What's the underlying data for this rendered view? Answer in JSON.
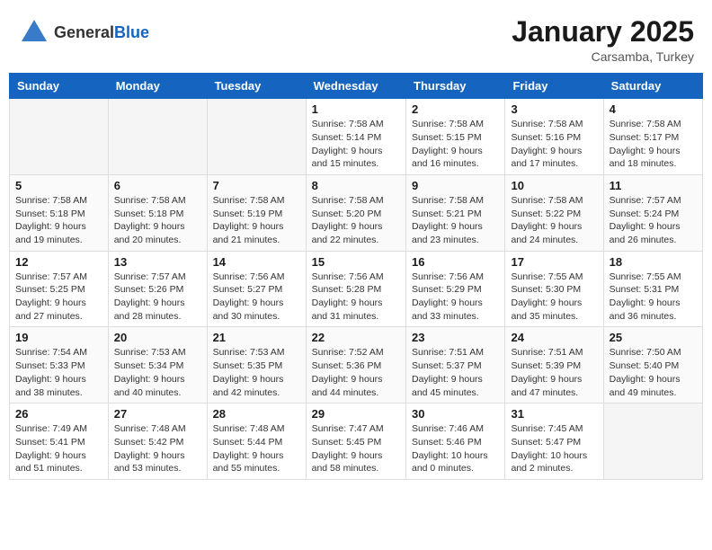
{
  "header": {
    "logo_general": "General",
    "logo_blue": "Blue",
    "month": "January 2025",
    "location": "Carsamba, Turkey"
  },
  "weekdays": [
    "Sunday",
    "Monday",
    "Tuesday",
    "Wednesday",
    "Thursday",
    "Friday",
    "Saturday"
  ],
  "weeks": [
    [
      {
        "day": "",
        "info": ""
      },
      {
        "day": "",
        "info": ""
      },
      {
        "day": "",
        "info": ""
      },
      {
        "day": "1",
        "info": "Sunrise: 7:58 AM\nSunset: 5:14 PM\nDaylight: 9 hours\nand 15 minutes."
      },
      {
        "day": "2",
        "info": "Sunrise: 7:58 AM\nSunset: 5:15 PM\nDaylight: 9 hours\nand 16 minutes."
      },
      {
        "day": "3",
        "info": "Sunrise: 7:58 AM\nSunset: 5:16 PM\nDaylight: 9 hours\nand 17 minutes."
      },
      {
        "day": "4",
        "info": "Sunrise: 7:58 AM\nSunset: 5:17 PM\nDaylight: 9 hours\nand 18 minutes."
      }
    ],
    [
      {
        "day": "5",
        "info": "Sunrise: 7:58 AM\nSunset: 5:18 PM\nDaylight: 9 hours\nand 19 minutes."
      },
      {
        "day": "6",
        "info": "Sunrise: 7:58 AM\nSunset: 5:18 PM\nDaylight: 9 hours\nand 20 minutes."
      },
      {
        "day": "7",
        "info": "Sunrise: 7:58 AM\nSunset: 5:19 PM\nDaylight: 9 hours\nand 21 minutes."
      },
      {
        "day": "8",
        "info": "Sunrise: 7:58 AM\nSunset: 5:20 PM\nDaylight: 9 hours\nand 22 minutes."
      },
      {
        "day": "9",
        "info": "Sunrise: 7:58 AM\nSunset: 5:21 PM\nDaylight: 9 hours\nand 23 minutes."
      },
      {
        "day": "10",
        "info": "Sunrise: 7:58 AM\nSunset: 5:22 PM\nDaylight: 9 hours\nand 24 minutes."
      },
      {
        "day": "11",
        "info": "Sunrise: 7:57 AM\nSunset: 5:24 PM\nDaylight: 9 hours\nand 26 minutes."
      }
    ],
    [
      {
        "day": "12",
        "info": "Sunrise: 7:57 AM\nSunset: 5:25 PM\nDaylight: 9 hours\nand 27 minutes."
      },
      {
        "day": "13",
        "info": "Sunrise: 7:57 AM\nSunset: 5:26 PM\nDaylight: 9 hours\nand 28 minutes."
      },
      {
        "day": "14",
        "info": "Sunrise: 7:56 AM\nSunset: 5:27 PM\nDaylight: 9 hours\nand 30 minutes."
      },
      {
        "day": "15",
        "info": "Sunrise: 7:56 AM\nSunset: 5:28 PM\nDaylight: 9 hours\nand 31 minutes."
      },
      {
        "day": "16",
        "info": "Sunrise: 7:56 AM\nSunset: 5:29 PM\nDaylight: 9 hours\nand 33 minutes."
      },
      {
        "day": "17",
        "info": "Sunrise: 7:55 AM\nSunset: 5:30 PM\nDaylight: 9 hours\nand 35 minutes."
      },
      {
        "day": "18",
        "info": "Sunrise: 7:55 AM\nSunset: 5:31 PM\nDaylight: 9 hours\nand 36 minutes."
      }
    ],
    [
      {
        "day": "19",
        "info": "Sunrise: 7:54 AM\nSunset: 5:33 PM\nDaylight: 9 hours\nand 38 minutes."
      },
      {
        "day": "20",
        "info": "Sunrise: 7:53 AM\nSunset: 5:34 PM\nDaylight: 9 hours\nand 40 minutes."
      },
      {
        "day": "21",
        "info": "Sunrise: 7:53 AM\nSunset: 5:35 PM\nDaylight: 9 hours\nand 42 minutes."
      },
      {
        "day": "22",
        "info": "Sunrise: 7:52 AM\nSunset: 5:36 PM\nDaylight: 9 hours\nand 44 minutes."
      },
      {
        "day": "23",
        "info": "Sunrise: 7:51 AM\nSunset: 5:37 PM\nDaylight: 9 hours\nand 45 minutes."
      },
      {
        "day": "24",
        "info": "Sunrise: 7:51 AM\nSunset: 5:39 PM\nDaylight: 9 hours\nand 47 minutes."
      },
      {
        "day": "25",
        "info": "Sunrise: 7:50 AM\nSunset: 5:40 PM\nDaylight: 9 hours\nand 49 minutes."
      }
    ],
    [
      {
        "day": "26",
        "info": "Sunrise: 7:49 AM\nSunset: 5:41 PM\nDaylight: 9 hours\nand 51 minutes."
      },
      {
        "day": "27",
        "info": "Sunrise: 7:48 AM\nSunset: 5:42 PM\nDaylight: 9 hours\nand 53 minutes."
      },
      {
        "day": "28",
        "info": "Sunrise: 7:48 AM\nSunset: 5:44 PM\nDaylight: 9 hours\nand 55 minutes."
      },
      {
        "day": "29",
        "info": "Sunrise: 7:47 AM\nSunset: 5:45 PM\nDaylight: 9 hours\nand 58 minutes."
      },
      {
        "day": "30",
        "info": "Sunrise: 7:46 AM\nSunset: 5:46 PM\nDaylight: 10 hours\nand 0 minutes."
      },
      {
        "day": "31",
        "info": "Sunrise: 7:45 AM\nSunset: 5:47 PM\nDaylight: 10 hours\nand 2 minutes."
      },
      {
        "day": "",
        "info": ""
      }
    ]
  ]
}
